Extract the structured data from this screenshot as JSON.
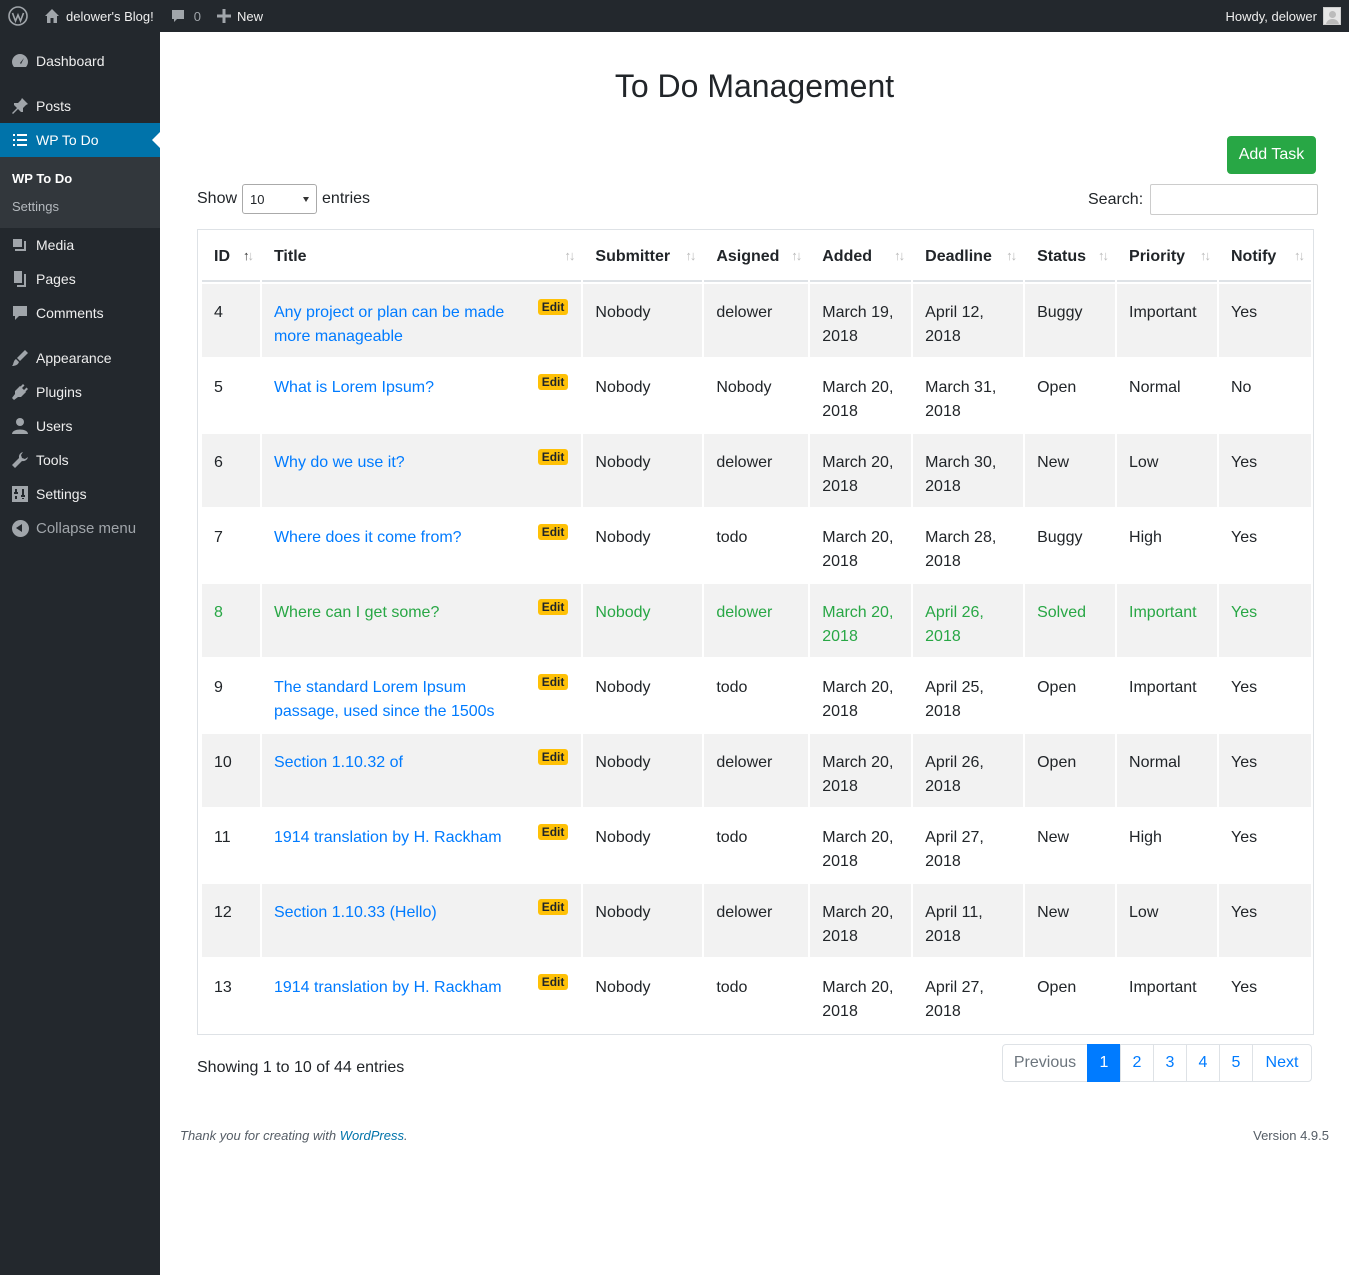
{
  "adminbar": {
    "site_name": "delower's Blog!",
    "comments_count": "0",
    "new_label": "New",
    "howdy": "Howdy, delower"
  },
  "sidebar": {
    "items": [
      {
        "label": "Dashboard",
        "icon": "dashboard-icon"
      },
      {
        "label": "Posts",
        "icon": "pin-icon"
      },
      {
        "label": "WP To Do",
        "icon": "list-icon",
        "current": true
      },
      {
        "label": "Media",
        "icon": "media-icon"
      },
      {
        "label": "Pages",
        "icon": "pages-icon"
      },
      {
        "label": "Comments",
        "icon": "comment-icon"
      },
      {
        "label": "Appearance",
        "icon": "brush-icon"
      },
      {
        "label": "Plugins",
        "icon": "plug-icon"
      },
      {
        "label": "Users",
        "icon": "user-icon"
      },
      {
        "label": "Tools",
        "icon": "wrench-icon"
      },
      {
        "label": "Settings",
        "icon": "sliders-icon"
      }
    ],
    "submenu": [
      "WP To Do",
      "Settings"
    ],
    "collapse_label": "Collapse menu"
  },
  "page": {
    "title": "To Do Management",
    "add_button": "Add Task",
    "show_label": "Show",
    "entries_value": "10",
    "entries_label": "entries",
    "search_label": "Search:",
    "search_value": ""
  },
  "table": {
    "headers": [
      "ID",
      "Title",
      "Submitter",
      "Asigned",
      "Added",
      "Deadline",
      "Status",
      "Priority",
      "Notify"
    ],
    "edit_label": "Edit",
    "rows": [
      {
        "id": "4",
        "title": "Any project or plan can be made more manageable",
        "submitter": "Nobody",
        "assigned": "delower",
        "added": "March 19, 2018",
        "deadline": "April 12, 2018",
        "status": "Buggy",
        "priority": "Important",
        "notify": "Yes"
      },
      {
        "id": "5",
        "title": "What is Lorem Ipsum?",
        "submitter": "Nobody",
        "assigned": "Nobody",
        "added": "March 20, 2018",
        "deadline": "March 31, 2018",
        "status": "Open",
        "priority": "Normal",
        "notify": "No"
      },
      {
        "id": "6",
        "title": "Why do we use it?",
        "submitter": "Nobody",
        "assigned": "delower",
        "added": "March 20, 2018",
        "deadline": "March 30, 2018",
        "status": "New",
        "priority": "Low",
        "notify": "Yes"
      },
      {
        "id": "7",
        "title": "Where does it come from?",
        "submitter": "Nobody",
        "assigned": "todo",
        "added": "March 20, 2018",
        "deadline": "March 28, 2018",
        "status": "Buggy",
        "priority": "High",
        "notify": "Yes"
      },
      {
        "id": "8",
        "title": "Where can I get some?",
        "submitter": "Nobody",
        "assigned": "delower",
        "added": "March 20, 2018",
        "deadline": "April 26, 2018",
        "status": "Solved",
        "priority": "Important",
        "notify": "Yes"
      },
      {
        "id": "9",
        "title": "The standard Lorem Ipsum passage, used since the 1500s",
        "submitter": "Nobody",
        "assigned": "todo",
        "added": "March 20, 2018",
        "deadline": "April 25, 2018",
        "status": "Open",
        "priority": "Important",
        "notify": "Yes"
      },
      {
        "id": "10",
        "title": "Section 1.10.32 of",
        "submitter": "Nobody",
        "assigned": "delower",
        "added": "March 20, 2018",
        "deadline": "April 26, 2018",
        "status": "Open",
        "priority": "Normal",
        "notify": "Yes"
      },
      {
        "id": "11",
        "title": "1914 translation by H. Rackham",
        "submitter": "Nobody",
        "assigned": "todo",
        "added": "March 20, 2018",
        "deadline": "April 27, 2018",
        "status": "New",
        "priority": "High",
        "notify": "Yes"
      },
      {
        "id": "12",
        "title": "Section 1.10.33 (Hello)",
        "submitter": "Nobody",
        "assigned": "delower",
        "added": "March 20, 2018",
        "deadline": "April 11, 2018",
        "status": "New",
        "priority": "Low",
        "notify": "Yes"
      },
      {
        "id": "13",
        "title": "1914 translation by H. Rackham",
        "submitter": "Nobody",
        "assigned": "todo",
        "added": "March 20, 2018",
        "deadline": "April 27, 2018",
        "status": "Open",
        "priority": "Important",
        "notify": "Yes"
      }
    ]
  },
  "pagination": {
    "info": "Showing 1 to 10 of 44 entries",
    "previous": "Previous",
    "pages": [
      "1",
      "2",
      "3",
      "4",
      "5"
    ],
    "next": "Next",
    "current": "1"
  },
  "footer": {
    "thanks_prefix": "Thank you for creating with ",
    "thanks_link": "WordPress",
    "thanks_suffix": ".",
    "version": "Version 4.9.5"
  },
  "colors": {
    "admin_dark": "#23282d",
    "admin_blue": "#0073aa",
    "add_button": "#28a745",
    "link": "#007bff",
    "edit_badge": "#ffc107",
    "solved_row": "#28a745"
  }
}
